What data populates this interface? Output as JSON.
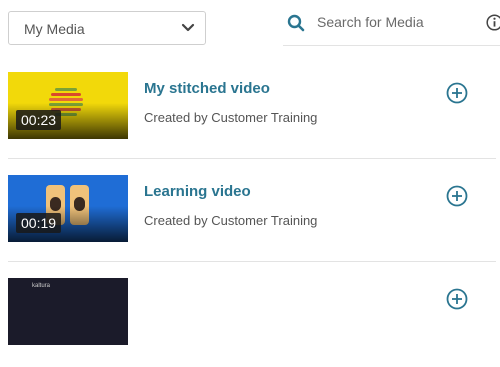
{
  "header": {
    "dropdown": {
      "selected": "My Media"
    },
    "search": {
      "placeholder": "Search for Media",
      "value": ""
    }
  },
  "media": [
    {
      "title": "My stitched video",
      "creator": "Created by Customer Training",
      "duration": "00:23"
    },
    {
      "title": "Learning video",
      "creator": "Created by Customer Training",
      "duration": "00:19"
    },
    {
      "title": "",
      "creator": "",
      "duration": "",
      "thumb_label": "kaltura"
    }
  ],
  "colors": {
    "accent": "#2a7590",
    "thumb_yellow": "#f2d90a",
    "thumb_blue": "#1f6dd6",
    "thumb_dark": "#1b1b2a"
  },
  "icons": {
    "dropdown": "chevron-down-icon",
    "search": "search-icon",
    "info": "info-icon",
    "add": "add-circle-icon"
  }
}
